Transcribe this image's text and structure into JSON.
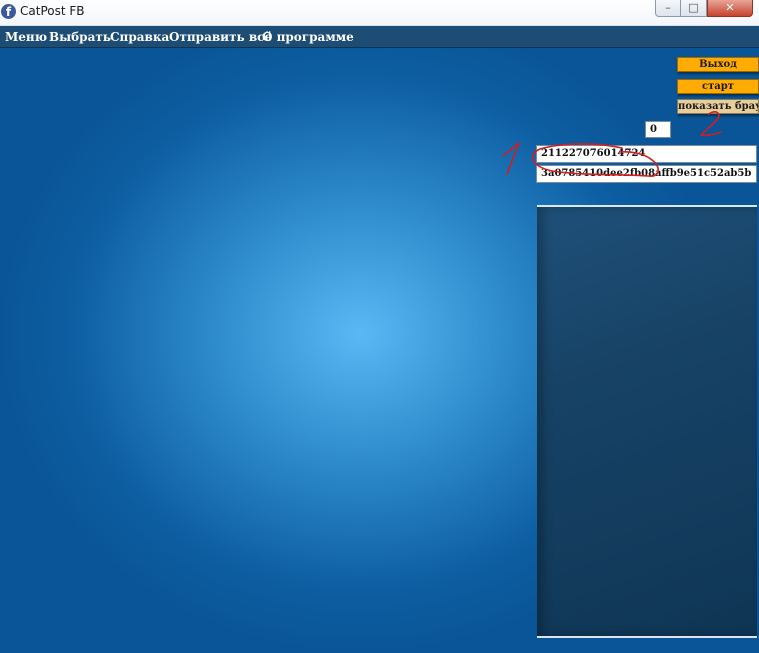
{
  "window": {
    "title": "CatPost FB",
    "logo_letter": "f",
    "controls": {
      "minimize": "–",
      "maximize": "□",
      "close": "✕"
    }
  },
  "menu": {
    "items": [
      "Меню",
      "Выбрать",
      "Справка",
      "Отправить всё",
      "О программе"
    ]
  },
  "panel": {
    "exit_button": "Выход",
    "start_button": "старт",
    "browser_button": "показать браузер",
    "counter_value": "0",
    "field_1_value": "211227076014724",
    "field_2_value": "3a0785410dee2fb08affb9e51c52ab5b"
  },
  "colors": {
    "accent_button": "#ffab00",
    "menubar": "#1d4d74",
    "annotation": "#d21e1e"
  }
}
